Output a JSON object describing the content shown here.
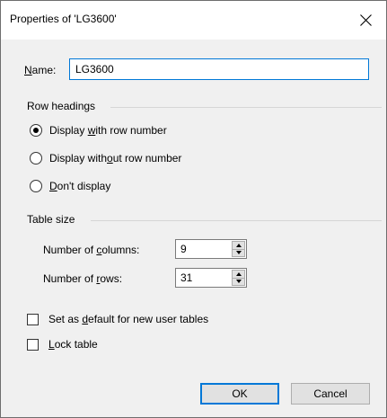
{
  "window": {
    "title": "Properties of 'LG3600'"
  },
  "name_field": {
    "label_accel": "N",
    "label_rest": "ame:",
    "value": "LG3600"
  },
  "row_headings": {
    "label": "Row headings",
    "options": [
      {
        "pre": "Display ",
        "accel": "w",
        "post": "ith row number",
        "selected": true
      },
      {
        "pre": "Display with",
        "accel": "o",
        "post": "ut row number",
        "selected": false
      },
      {
        "pre": "",
        "accel": "D",
        "post": "on't display",
        "selected": false
      }
    ]
  },
  "table_size": {
    "label": "Table size",
    "columns": {
      "pre": "Number of ",
      "accel": "c",
      "post": "olumns:",
      "value": "9"
    },
    "rows": {
      "pre": "Number of ",
      "accel": "r",
      "post": "ows:",
      "value": "31"
    }
  },
  "checkboxes": {
    "default": {
      "pre": "Set as ",
      "accel": "d",
      "post": "efault for new user tables",
      "checked": false
    },
    "lock": {
      "pre": "",
      "accel": "L",
      "post": "ock table",
      "checked": false
    }
  },
  "buttons": {
    "ok": "OK",
    "cancel": "Cancel"
  }
}
